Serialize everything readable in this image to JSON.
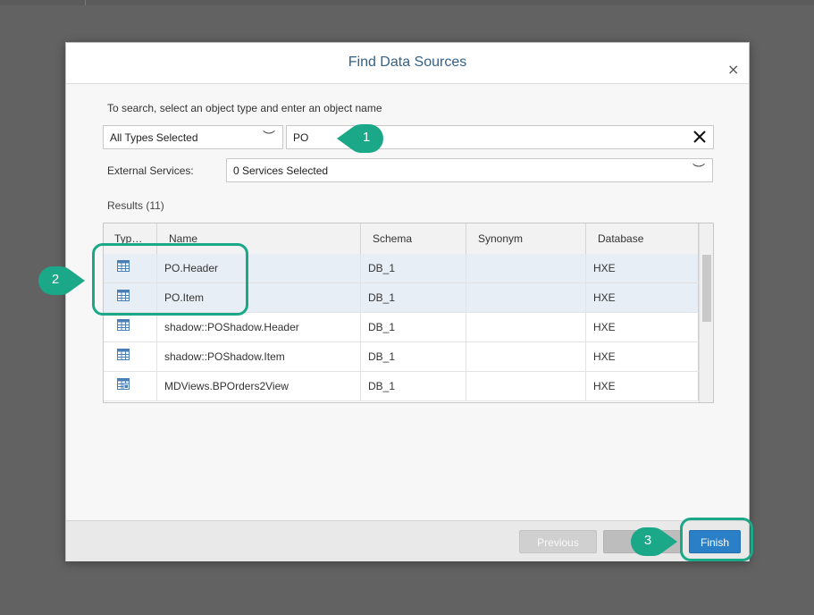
{
  "dialog": {
    "title": "Find Data Sources",
    "close_glyph": "×",
    "instruction": "To search, select an object type and enter an object name",
    "type_select": {
      "value": "All Types Selected",
      "chevron": "︶"
    },
    "search": {
      "value": "PO"
    },
    "external_services": {
      "label": "External Services:",
      "value": "0 Services Selected",
      "chevron": "︶"
    },
    "results_label": "Results (11)"
  },
  "table": {
    "columns": [
      "Typ…",
      "Name",
      "Schema",
      "Synonym",
      "Database"
    ],
    "rows": [
      {
        "icon": "table-icon",
        "name": "PO.Header",
        "schema": "DB_1",
        "synonym": "",
        "database": "HXE",
        "selected": true
      },
      {
        "icon": "table-icon",
        "name": "PO.Item",
        "schema": "DB_1",
        "synonym": "",
        "database": "HXE",
        "selected": true
      },
      {
        "icon": "table-icon",
        "name": "shadow::POShadow.Header",
        "schema": "DB_1",
        "synonym": "",
        "database": "HXE",
        "selected": false
      },
      {
        "icon": "table-icon",
        "name": "shadow::POShadow.Item",
        "schema": "DB_1",
        "synonym": "",
        "database": "HXE",
        "selected": false
      },
      {
        "icon": "view-icon",
        "name": "MDViews.BPOrders2View",
        "schema": "DB_1",
        "synonym": "",
        "database": "HXE",
        "selected": false
      }
    ]
  },
  "footer": {
    "previous_label": "Previous",
    "next_label": "",
    "finish_label": "Finish"
  },
  "callouts": [
    "1",
    "2",
    "3"
  ],
  "colors": {
    "accent": "#1aa889",
    "primary_button": "#2a7fc6",
    "title": "#346187",
    "selected_row": "#e8eef5"
  }
}
